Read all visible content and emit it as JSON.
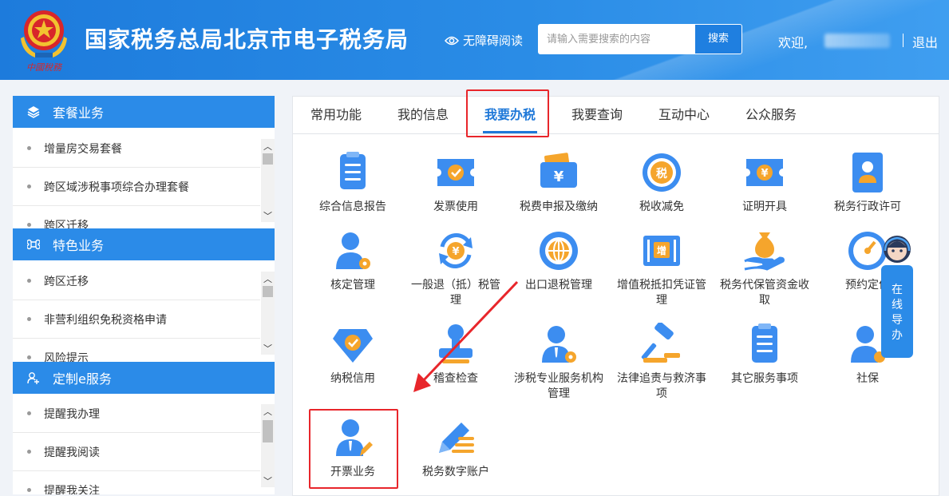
{
  "header": {
    "title": "国家税务总局北京市电子税务局",
    "emblem_caption": "中國稅務",
    "accessibility_label": "无障碍阅读",
    "search": {
      "placeholder": "请输入需要搜索的内容",
      "value": "",
      "button_label": "搜索"
    },
    "welcome_label": "欢迎,",
    "logout_label": "退出"
  },
  "sidebar": {
    "sections": [
      {
        "title": "套餐业务",
        "icon": "layers-icon",
        "items": [
          "增量房交易套餐",
          "跨区域涉税事项综合办理套餐",
          "跨区迁移"
        ]
      },
      {
        "title": "特色业务",
        "icon": "command-icon",
        "items": [
          "跨区迁移",
          "非营利组织免税资格申请",
          "风险提示"
        ]
      },
      {
        "title": "定制e服务",
        "icon": "user-add-icon",
        "items": [
          "提醒我办理",
          "提醒我阅读",
          "提醒我关注"
        ]
      }
    ]
  },
  "main": {
    "tabs": [
      "常用功能",
      "我的信息",
      "我要办税",
      "我要查询",
      "互动中心",
      "公众服务"
    ],
    "active_tab": "我要办税",
    "items": [
      {
        "label": "综合信息报告",
        "icon": "clipboard-report-icon"
      },
      {
        "label": "发票使用",
        "icon": "invoice-ticket-icon"
      },
      {
        "label": "税费申报及缴纳",
        "icon": "tax-payment-icon"
      },
      {
        "label": "税收减免",
        "icon": "tax-relief-icon"
      },
      {
        "label": "证明开具",
        "icon": "certificate-icon"
      },
      {
        "label": "税务行政许可",
        "icon": "admin-license-icon"
      },
      {
        "label": "核定管理",
        "icon": "user-gear-icon"
      },
      {
        "label": "一般退（抵）税管理",
        "icon": "refund-cycle-icon"
      },
      {
        "label": "出口退税管理",
        "icon": "globe-export-icon"
      },
      {
        "label": "增值税抵扣凭证管理",
        "icon": "vat-voucher-icon"
      },
      {
        "label": "税务代保管资金收取",
        "icon": "money-bag-hand-icon"
      },
      {
        "label": "预约定价",
        "icon": "pricing-dial-icon"
      },
      {
        "label": "纳税信用",
        "icon": "credit-diamond-icon"
      },
      {
        "label": "稽查检查",
        "icon": "inspection-stamp-icon"
      },
      {
        "label": "涉税专业服务机构管理",
        "icon": "agency-user-gear-icon"
      },
      {
        "label": "法律追责与救济事项",
        "icon": "legal-gavel-icon"
      },
      {
        "label": "其它服务事项",
        "icon": "other-services-icon"
      },
      {
        "label": "社保",
        "icon": "social-security-icon"
      },
      {
        "label": "开票业务",
        "icon": "invoicing-user-pen-icon"
      },
      {
        "label": "税务数字账户",
        "icon": "digital-account-pen-icon"
      }
    ]
  },
  "online_guide": {
    "label": "在线导办"
  },
  "colors": {
    "primary": "#2b8be8",
    "header": "#1d7bdc",
    "highlight": "#e8262b",
    "text": "#333333"
  }
}
